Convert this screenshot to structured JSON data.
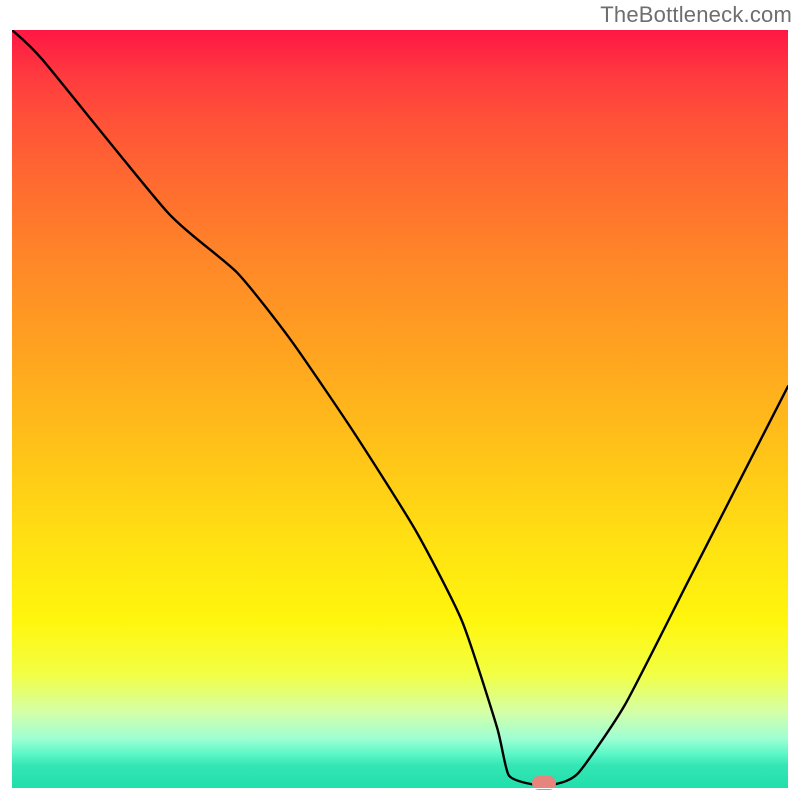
{
  "watermark": "TheBottleneck.com",
  "chart_data": {
    "type": "line",
    "title": "",
    "xlabel": "",
    "ylabel": "",
    "xlim": [
      0,
      100
    ],
    "ylim": [
      0,
      100
    ],
    "grid": false,
    "series": [
      {
        "name": "bottleneck-curve",
        "x": [
          0,
          4,
          20,
          29,
          36,
          44,
          52,
          58,
          62.5,
          64,
          67,
          70,
          73,
          79,
          87,
          94,
          100
        ],
        "values": [
          100,
          96,
          76,
          68,
          59,
          47,
          34,
          22,
          8,
          1.7,
          0.5,
          0.5,
          2,
          11,
          27,
          41,
          53
        ]
      }
    ],
    "markers": [
      {
        "name": "optimal-point",
        "x": 68.5,
        "y": 0.6,
        "color": "#e6857e"
      }
    ],
    "gradient_stops": [
      {
        "pos": 0,
        "color": "#ff1744"
      },
      {
        "pos": 50,
        "color": "#ffbe18"
      },
      {
        "pos": 80,
        "color": "#fff60d"
      },
      {
        "pos": 100,
        "color": "#1fdfab"
      }
    ]
  }
}
